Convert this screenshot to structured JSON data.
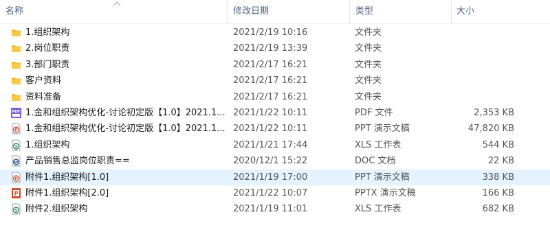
{
  "header": {
    "name": "名称",
    "date": "修改日期",
    "type": "类型",
    "size": "大小"
  },
  "colors": {
    "folder": "#f0b429",
    "pdf": "#7b5fd9",
    "ppt": "#d04a2c",
    "xls": "#2e8b57",
    "doc": "#2b5797",
    "selected_row": "#e5f3ff",
    "header_text": "#4d6082"
  },
  "rows": [
    {
      "icon": "folder-icon",
      "name": "1.组织架构",
      "date": "2021/2/19 10:16",
      "type": "文件夹",
      "size": ""
    },
    {
      "icon": "folder-icon",
      "name": "2.岗位职责",
      "date": "2021/2/19 13:39",
      "type": "文件夹",
      "size": ""
    },
    {
      "icon": "folder-icon",
      "name": "3.部门职责",
      "date": "2021/2/17 16:21",
      "type": "文件夹",
      "size": ""
    },
    {
      "icon": "folder-icon",
      "name": "客户资料",
      "date": "2021/2/17 16:21",
      "type": "文件夹",
      "size": ""
    },
    {
      "icon": "folder-icon",
      "name": "资料准备",
      "date": "2021/2/17 16:21",
      "type": "文件夹",
      "size": ""
    },
    {
      "icon": "pdf-icon",
      "name": "1.金和组织架构优化-讨论初定版【1.0】2021.1...",
      "date": "2021/1/22 10:11",
      "type": "PDF 文件",
      "size": "2,353 KB"
    },
    {
      "icon": "ppt-icon",
      "name": "1.金和组织架构优化-讨论初定版【1.0】2021.1...",
      "date": "2021/1/22 10:11",
      "type": "PPT 演示文稿",
      "size": "47,820 KB"
    },
    {
      "icon": "xls-icon",
      "name": "1.组织架构",
      "date": "2021/1/21 17:44",
      "type": "XLS 工作表",
      "size": "544 KB"
    },
    {
      "icon": "doc-icon",
      "name": "产品销售总监岗位职责==",
      "date": "2020/12/1 15:22",
      "type": "DOC 文档",
      "size": "22 KB"
    },
    {
      "icon": "ppt-icon",
      "name": "附件1.组织架构[1.0]",
      "date": "2021/1/19 17:00",
      "type": "PPT 演示文稿",
      "size": "338 KB",
      "selected": true
    },
    {
      "icon": "pptx-icon",
      "name": "附件1.组织架构[2.0]",
      "date": "2021/1/22 10:07",
      "type": "PPTX 演示文稿",
      "size": "166 KB"
    },
    {
      "icon": "xls-icon",
      "name": "附件2.组织架构",
      "date": "2021/1/19 11:01",
      "type": "XLS 工作表",
      "size": "682 KB"
    }
  ]
}
